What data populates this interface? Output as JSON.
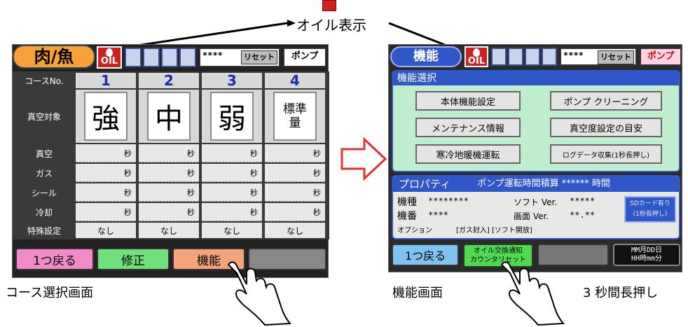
{
  "annotations": {
    "oil_display": "オイル表示",
    "course_screen": "コース選択画面",
    "function_screen": "機能画面",
    "long_press": "3 秒間長押し"
  },
  "left": {
    "mode_title": "肉/魚",
    "oil_text": "OIL",
    "counter_stars": "****",
    "reset": "リセット",
    "pump": "ポンプ",
    "course_no_label": "コースNo.",
    "columns": [
      "1",
      "2",
      "3",
      "4"
    ],
    "target_label": "真空対象",
    "targets": [
      "強",
      "中",
      "弱",
      "標準\n量"
    ],
    "row_labels": [
      "真空",
      "ガス",
      "シール",
      "冷却"
    ],
    "sec": "秒",
    "special_label": "特殊設定",
    "special_values": [
      "なし",
      "なし",
      "なし",
      "なし"
    ],
    "buttons": {
      "back": "1つ戻る",
      "edit": "修正",
      "func": "機能"
    }
  },
  "right": {
    "title": "機能",
    "oil_text": "OIL",
    "counter_stars": "****",
    "reset": "リセット",
    "pump": "ポンプ",
    "select_header": "機能選択",
    "function_buttons": [
      "本体機能設定",
      "ポンプ クリーニング",
      "メンテナンス情報",
      "真空度設定の目安",
      "寒冷地暖機運転",
      "ログデータ収集(1秒長押し)"
    ],
    "property_header": "プロパティ",
    "pump_time": "ポンプ運転時間積算 ****** 時間",
    "model_label": "機種",
    "model_value": "********",
    "soft_label": "ソフト Ver.",
    "soft_value": "*****",
    "serial_label": "機番",
    "serial_value": "****",
    "screen_label": "画面 Ver.",
    "screen_value": "**.**",
    "option_label": "オプション",
    "option_value": "[ガス封入] [ソフト開放]",
    "sd_button": "SDカード有り\n(1秒長押し)",
    "buttons": {
      "back": "1つ戻る",
      "oil_reset": "オイル交換通知\nカウンタリセット"
    },
    "datetime": "MM月DD日\nHH時mm分"
  },
  "colors": {
    "accent_orange": "#f7a13a",
    "accent_blue": "#2f57c8",
    "arrow_red": "#e53030",
    "panel_green": "#bfeecf"
  }
}
